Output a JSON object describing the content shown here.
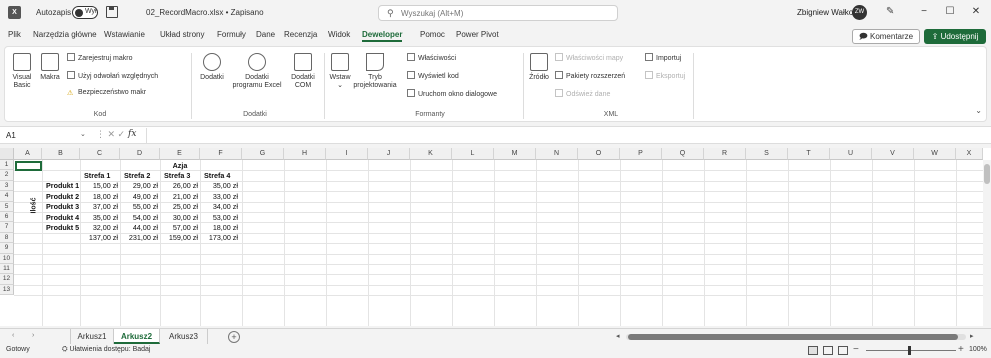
{
  "titlebar": {
    "autosave_label": "Autozapis",
    "autosave_state": "Wył.",
    "doc_title": "02_RecordMacro.xlsx • Zapisano",
    "search_placeholder": "Wyszukaj (Alt+M)",
    "user_name": "Zbigniew Wałko",
    "user_initials": "ZW",
    "minimize": "−",
    "maximize": "☐",
    "close": "✕"
  },
  "menu": {
    "tabs": [
      "Plik",
      "Narzędzia główne",
      "Wstawianie",
      "Układ strony",
      "Formuły",
      "Dane",
      "Recenzja",
      "Widok",
      "Deweloper",
      "Pomoc",
      "Power Pivot"
    ],
    "active": "Deweloper",
    "comments": "Komentarze",
    "share": "Udostępnij"
  },
  "ribbon": {
    "kod": {
      "label": "Kod",
      "visual_basic": [
        "Visual",
        "Basic"
      ],
      "makra": "Makra",
      "record": "Zarejestruj makro",
      "relative": "Użyj odwołań względnych",
      "security": "Bezpieczeństwo makr"
    },
    "dodatki": {
      "label": "Dodatki",
      "dodatki": "Dodatki",
      "excel_addins": [
        "Dodatki",
        "programu Excel"
      ],
      "com_addins": [
        "Dodatki",
        "COM"
      ]
    },
    "formanty": {
      "label": "Formanty",
      "wstaw": "Wstaw",
      "tryb": [
        "Tryb",
        "projektowania"
      ],
      "wlasciwosci": "Właściwości",
      "wyswietl_kod": "Wyświetl kod",
      "uruchom": "Uruchom okno dialogowe"
    },
    "xml": {
      "label": "XML",
      "zrodlo": "Źródło",
      "wlasciwosci_mapy": "Właściwości mapy",
      "pakiety": "Pakiety rozszerzeń",
      "odswiez": "Odśwież dane",
      "importuj": "Importuj",
      "eksportuj": "Eksportuj"
    }
  },
  "formula_bar": {
    "name_box": "A1",
    "fx": "fx",
    "value": ""
  },
  "sheet": {
    "columns": [
      "A",
      "B",
      "C",
      "D",
      "E",
      "F",
      "G",
      "H",
      "I",
      "J",
      "K",
      "L",
      "M",
      "N",
      "O",
      "P",
      "Q",
      "R",
      "S",
      "T",
      "U",
      "V",
      "W",
      "X"
    ],
    "rows": [
      "1",
      "2",
      "3",
      "4",
      "5",
      "6",
      "7",
      "8",
      "9",
      "10",
      "11",
      "12",
      "13"
    ],
    "header_region": "Azja",
    "header_zones": [
      "Strefa 1",
      "Strefa 2",
      "Strefa 3",
      "Strefa 4"
    ],
    "vertical_label": "Ilość",
    "products": [
      {
        "name": "Produkt 1",
        "values": [
          "15,00 zł",
          "29,00 zł",
          "26,00 zł",
          "35,00 zł"
        ]
      },
      {
        "name": "Produkt 2",
        "values": [
          "18,00 zł",
          "49,00 zł",
          "21,00 zł",
          "33,00 zł"
        ]
      },
      {
        "name": "Produkt 3",
        "values": [
          "37,00 zł",
          "55,00 zł",
          "25,00 zł",
          "34,00 zł"
        ]
      },
      {
        "name": "Produkt 4",
        "values": [
          "35,00 zł",
          "54,00 zł",
          "30,00 zł",
          "53,00 zł"
        ]
      },
      {
        "name": "Produkt 5",
        "values": [
          "32,00 zł",
          "44,00 zł",
          "57,00 zł",
          "18,00 zł"
        ]
      }
    ],
    "totals": [
      "137,00 zł",
      "231,00 zł",
      "159,00 zł",
      "173,00 zł"
    ]
  },
  "sheet_tabs": {
    "tabs": [
      "Arkusz1",
      "Arkusz2",
      "Arkusz3"
    ],
    "active": "Arkusz2",
    "add": "+"
  },
  "status": {
    "ready": "Gotowy",
    "accessibility": "Ułatwienia dostępu: Badaj",
    "zoom": "100%"
  }
}
